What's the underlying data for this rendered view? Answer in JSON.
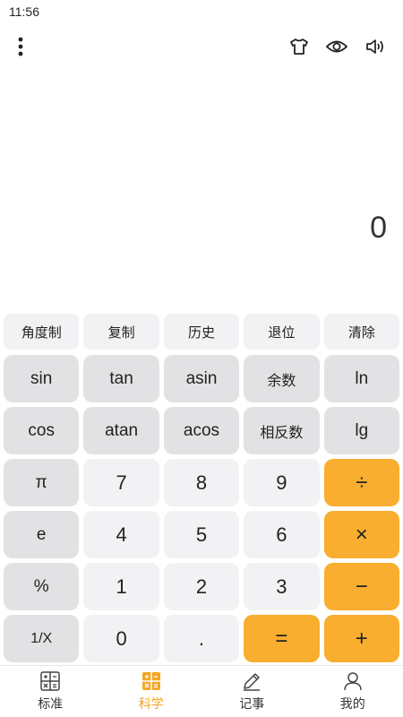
{
  "status_bar": {
    "time": "11:56"
  },
  "toolbar": {
    "menu_icon": "more-vertical-icon",
    "icons": [
      "tshirt-icon",
      "eye-icon",
      "speaker-icon"
    ]
  },
  "display": {
    "value": "0"
  },
  "function_row": [
    "角度制",
    "复制",
    "历史",
    "退位",
    "清除"
  ],
  "keys": [
    [
      "sin",
      "tan",
      "asin",
      "余数",
      "ln"
    ],
    [
      "cos",
      "atan",
      "acos",
      "相反数",
      "lg"
    ],
    [
      "π",
      "7",
      "8",
      "9",
      "÷"
    ],
    [
      "e",
      "4",
      "5",
      "6",
      "×"
    ],
    [
      "%",
      "1",
      "2",
      "3",
      "−"
    ],
    [
      "1/X",
      "0",
      ".",
      "=",
      "+"
    ]
  ],
  "tabs": [
    {
      "label": "标准",
      "icon": "standard-calculator-icon"
    },
    {
      "label": "科学",
      "icon": "scientific-calculator-icon",
      "active": true
    },
    {
      "label": "记事",
      "icon": "pencil-icon"
    },
    {
      "label": "我的",
      "icon": "user-icon"
    }
  ],
  "colors": {
    "accent": "#f9ae2f",
    "active_tab": "#f5a623",
    "key_gray": "#e2e2e4",
    "key_light": "#f2f2f4"
  }
}
